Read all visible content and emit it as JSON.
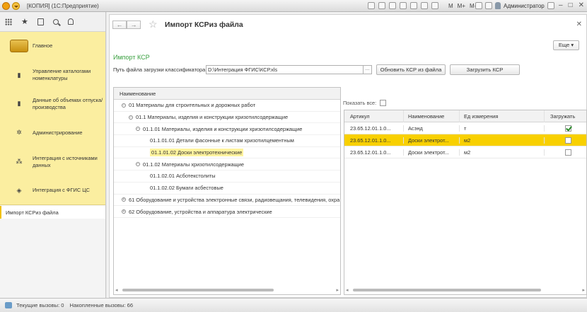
{
  "window": {
    "title": "[КОПИЯ] (1С:Предприятие)",
    "toolbar_m": [
      "M",
      "M+",
      "M-"
    ],
    "user": "Администратор"
  },
  "sidebar": {
    "sections": [
      {
        "label": "Главное",
        "icon": "home-icon"
      },
      {
        "label": "Управление каталогами номенклатуры",
        "icon": "catalog-icon"
      },
      {
        "label": "Данные об объемах отпуска/производства",
        "icon": "data-icon"
      },
      {
        "label": "Администрирование",
        "icon": "gear-icon"
      },
      {
        "label": "Интеграция с источниками данных",
        "icon": "integration-icon"
      },
      {
        "label": "Интеграция с ФГИС ЦС",
        "icon": "fgis-icon"
      }
    ],
    "open_item": "Импорт КСРиз файла"
  },
  "page": {
    "title": "Импорт КСРиз файла",
    "more_button": "Еще",
    "form_title": "Импорт КСР",
    "path_label": "Путь файла загрузки классификатора:",
    "path_value": "D:\\Интеграция ФГИС\\КСР.xls",
    "path_select": "...",
    "update_button": "Обновить КСР из файла",
    "load_button": "Загрузить КСР",
    "show_all_label": "Показать все:"
  },
  "tree": {
    "header": "Наименование",
    "rows": [
      {
        "level": 0,
        "toggle": "−",
        "text": "01 Материалы для строительных и дорожных работ"
      },
      {
        "level": 1,
        "toggle": "−",
        "text": "01.1 Материалы, изделия и конструкции хризотилсодержащие"
      },
      {
        "level": 2,
        "toggle": "−",
        "text": "01.1.01 Материалы, изделия и конструкции хризотилсодержащие"
      },
      {
        "level": 3,
        "toggle": "",
        "text": "01.1.01.01 Детали фасонные к листам хризотилцементным"
      },
      {
        "level": 3,
        "toggle": "",
        "text": "01.1.01.02 Доски электротехнические",
        "selected": true
      },
      {
        "level": 2,
        "toggle": "−",
        "text": "01.1.02 Материалы хризотилсодержащие"
      },
      {
        "level": 3,
        "toggle": "",
        "text": "01.1.02.01 Асботекстолиты"
      },
      {
        "level": 3,
        "toggle": "",
        "text": "01.1.02.02 Бумаги асбестовые"
      },
      {
        "level": 0,
        "toggle": "+",
        "text": "61 Оборудование и устройства электронные связи, радиовещания, телевидения, охра"
      },
      {
        "level": 0,
        "toggle": "+",
        "text": "62 Оборудование, устройства и аппаратура электрические"
      }
    ]
  },
  "grid": {
    "columns": [
      "Артикул",
      "Наименование",
      "Ед измерения",
      "Загружать"
    ],
    "rows": [
      {
        "article": "23.65.12.01.1.0...",
        "name": "Асэнд",
        "unit": "т",
        "load": true,
        "selected": false
      },
      {
        "article": "23.65.12.01.1.0...",
        "name": "Доски электрот...",
        "unit": "м2",
        "load": false,
        "selected": true
      },
      {
        "article": "23.65.12.01.1.0...",
        "name": "Доски электрот...",
        "unit": "м2",
        "load": false,
        "selected": false
      }
    ]
  },
  "status": {
    "current_calls": "Текущие вызовы: 0",
    "accumulated_calls": "Накопленные вызовы: 66"
  }
}
